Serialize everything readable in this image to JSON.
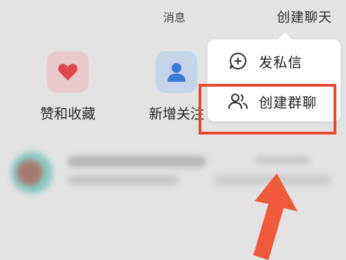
{
  "header": {
    "title": "消息",
    "create_chat_label": "创建聊天"
  },
  "quick_actions": [
    {
      "label": "赞和收藏",
      "icon": "heart-icon",
      "tile_color": "#e8c9cc",
      "icon_color": "#e0474c"
    },
    {
      "label": "新增关注",
      "icon": "person-icon",
      "tile_color": "#c5d4e8",
      "icon_color": "#3a7bd5"
    }
  ],
  "popup_menu": {
    "items": [
      {
        "label": "发私信",
        "icon": "plus-chat-icon"
      },
      {
        "label": "创建群聊",
        "icon": "group-icon"
      }
    ]
  },
  "annotation": {
    "highlight_color": "#e64a2e",
    "arrow_color": "#f05a3a"
  }
}
